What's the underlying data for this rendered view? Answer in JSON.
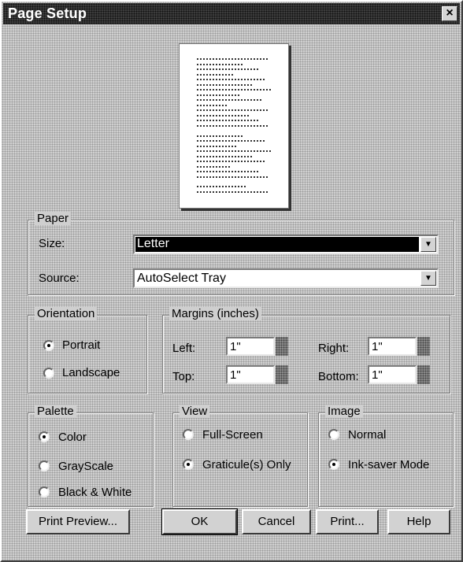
{
  "window": {
    "title": "Page Setup",
    "close_glyph": "×"
  },
  "paper": {
    "legend": "Paper",
    "size_label": "Size:",
    "size_value": "Letter",
    "source_label": "Source:",
    "source_value": "AutoSelect Tray"
  },
  "orientation": {
    "legend": "Orientation",
    "portrait": "Portrait",
    "landscape": "Landscape",
    "selected": "portrait"
  },
  "margins": {
    "legend": "Margins (inches)",
    "left_label": "Left:",
    "left_value": "1\"",
    "right_label": "Right:",
    "right_value": "1\"",
    "top_label": "Top:",
    "top_value": "1\"",
    "bottom_label": "Bottom:",
    "bottom_value": "1\""
  },
  "palette": {
    "legend": "Palette",
    "color": "Color",
    "grayscale": "GrayScale",
    "bw": "Black & White",
    "selected": "color"
  },
  "view": {
    "legend": "View",
    "fullscreen": "Full-Screen",
    "graticule": "Graticule(s) Only",
    "selected": "graticule"
  },
  "image": {
    "legend": "Image",
    "normal": "Normal",
    "inksaver": "Ink-saver Mode",
    "selected": "inksaver"
  },
  "buttons": {
    "print_preview": "Print Preview...",
    "ok": "OK",
    "cancel": "Cancel",
    "print": "Print...",
    "help": "Help"
  },
  "dropdown_glyph": "▼"
}
